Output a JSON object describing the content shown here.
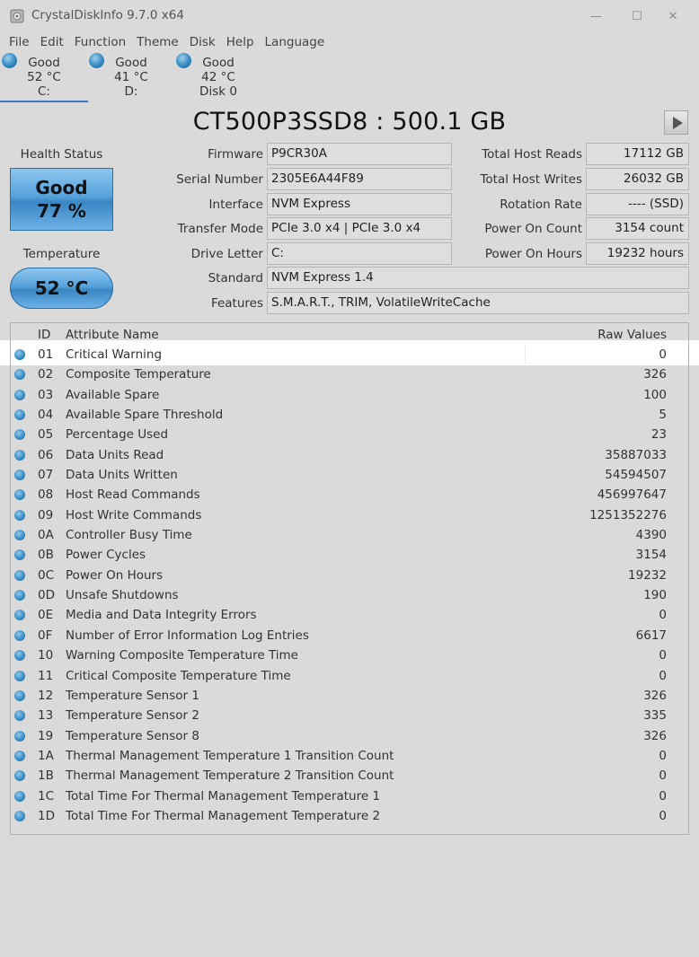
{
  "window": {
    "title": "CrystalDiskInfo 9.7.0 x64",
    "controls": {
      "minimize": "—",
      "maximize": "☐",
      "close": "✕"
    }
  },
  "menu": [
    "File",
    "Edit",
    "Function",
    "Theme",
    "Disk",
    "Help",
    "Language"
  ],
  "disks": [
    {
      "status": "Good",
      "temp": "52 °C",
      "name": "C:"
    },
    {
      "status": "Good",
      "temp": "41 °C",
      "name": "D:"
    },
    {
      "status": "Good",
      "temp": "42 °C",
      "name": "Disk 0"
    }
  ],
  "model": "CT500P3SSD8 : 500.1 GB",
  "health": {
    "label": "Health Status",
    "status": "Good",
    "percent": "77 %"
  },
  "temperature": {
    "label": "Temperature",
    "value": "52 °C"
  },
  "info": {
    "firmware": {
      "label": "Firmware",
      "value": "P9CR30A"
    },
    "serial": {
      "label": "Serial Number",
      "value": "2305E6A44F89"
    },
    "interface": {
      "label": "Interface",
      "value": "NVM Express"
    },
    "transfer": {
      "label": "Transfer Mode",
      "value": "PCIe 3.0 x4 | PCIe 3.0 x4"
    },
    "letter": {
      "label": "Drive Letter",
      "value": "C:"
    },
    "standard": {
      "label": "Standard",
      "value": "NVM Express 1.4"
    },
    "features": {
      "label": "Features",
      "value": "S.M.A.R.T., TRIM, VolatileWriteCache"
    },
    "host_reads": {
      "label": "Total Host Reads",
      "value": "17112 GB"
    },
    "host_writes": {
      "label": "Total Host Writes",
      "value": "26032 GB"
    },
    "rotation": {
      "label": "Rotation Rate",
      "value": "---- (SSD)"
    },
    "power_count": {
      "label": "Power On Count",
      "value": "3154 count"
    },
    "power_hours": {
      "label": "Power On Hours",
      "value": "19232 hours"
    }
  },
  "table": {
    "headers": {
      "id": "ID",
      "name": "Attribute Name",
      "raw": "Raw Values"
    },
    "rows": [
      {
        "id": "01",
        "name": "Critical Warning",
        "raw": "0"
      },
      {
        "id": "02",
        "name": "Composite Temperature",
        "raw": "326"
      },
      {
        "id": "03",
        "name": "Available Spare",
        "raw": "100"
      },
      {
        "id": "04",
        "name": "Available Spare Threshold",
        "raw": "5"
      },
      {
        "id": "05",
        "name": "Percentage Used",
        "raw": "23"
      },
      {
        "id": "06",
        "name": "Data Units Read",
        "raw": "35887033"
      },
      {
        "id": "07",
        "name": "Data Units Written",
        "raw": "54594507"
      },
      {
        "id": "08",
        "name": "Host Read Commands",
        "raw": "456997647"
      },
      {
        "id": "09",
        "name": "Host Write Commands",
        "raw": "1251352276"
      },
      {
        "id": "0A",
        "name": "Controller Busy Time",
        "raw": "4390"
      },
      {
        "id": "0B",
        "name": "Power Cycles",
        "raw": "3154"
      },
      {
        "id": "0C",
        "name": "Power On Hours",
        "raw": "19232"
      },
      {
        "id": "0D",
        "name": "Unsafe Shutdowns",
        "raw": "190"
      },
      {
        "id": "0E",
        "name": "Media and Data Integrity Errors",
        "raw": "0"
      },
      {
        "id": "0F",
        "name": "Number of Error Information Log Entries",
        "raw": "6617"
      },
      {
        "id": "10",
        "name": "Warning Composite Temperature Time",
        "raw": "0"
      },
      {
        "id": "11",
        "name": "Critical Composite Temperature Time",
        "raw": "0"
      },
      {
        "id": "12",
        "name": "Temperature Sensor 1",
        "raw": "326"
      },
      {
        "id": "13",
        "name": "Temperature Sensor 2",
        "raw": "335"
      },
      {
        "id": "19",
        "name": "Temperature Sensor 8",
        "raw": "326"
      },
      {
        "id": "1A",
        "name": "Thermal Management Temperature 1 Transition Count",
        "raw": "0"
      },
      {
        "id": "1B",
        "name": "Thermal Management Temperature 2 Transition Count",
        "raw": "0"
      },
      {
        "id": "1C",
        "name": "Total Time For Thermal Management Temperature 1",
        "raw": "0"
      },
      {
        "id": "1D",
        "name": "Total Time For Thermal Management Temperature 2",
        "raw": "0"
      }
    ]
  }
}
